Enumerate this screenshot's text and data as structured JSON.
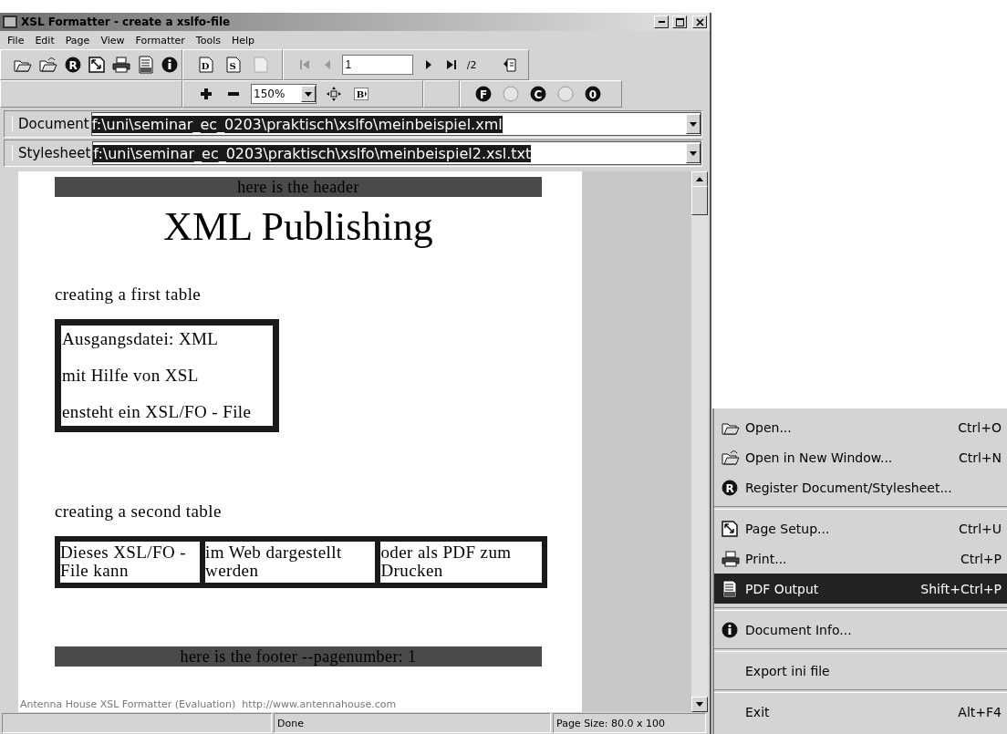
{
  "window": {
    "title": "XSL Formatter - create a xslfo-file"
  },
  "menu_bar": [
    "File",
    "Edit",
    "Page",
    "View",
    "Formatter",
    "Tools",
    "Help"
  ],
  "toolbar": {
    "file_buttons": [
      {
        "kind": "open"
      },
      {
        "kind": "open-new"
      },
      {
        "kind": "letter",
        "letter": "R"
      },
      {
        "kind": "page-setup"
      },
      {
        "kind": "print"
      },
      {
        "kind": "pdf"
      },
      {
        "kind": "info"
      }
    ],
    "view_buttons": [
      {
        "kind": "doc",
        "letter": "D",
        "disabled": false
      },
      {
        "kind": "doc",
        "letter": "S",
        "disabled": false
      },
      {
        "kind": "doc",
        "disabled": true
      }
    ],
    "nav": {
      "first_disabled": true,
      "prev_disabled": true,
      "page": "1",
      "next_disabled": false,
      "last_disabled": false,
      "total": "/2"
    },
    "zoom": {
      "value": "150%",
      "fit_width_letter": "B"
    },
    "mode_buttons": [
      {
        "letter": "F",
        "disabled": false
      },
      {
        "disabled": true
      },
      {
        "letter": "C",
        "disabled": false
      },
      {
        "disabled": true
      },
      {
        "letter": "0",
        "disabled": false
      }
    ]
  },
  "sources": [
    {
      "label": "Document",
      "value": "f:\\uni\\seminar_ec_0203\\praktisch\\xslfo\\meinbeispiel.xml",
      "selected": true
    },
    {
      "label": "Stylesheet",
      "value": "f:\\uni\\seminar_ec_0203\\praktisch\\xslfo\\meinbeispiel2.xsl.txt",
      "selected": true
    }
  ],
  "page": {
    "header": "here is the header",
    "title": "XML Publishing",
    "intro_1": "creating a first table",
    "table_1": [
      "Ausgangsdatei: XML",
      "mit Hilfe von XSL",
      "ensteht ein XSL/FO - File"
    ],
    "intro_2": "creating a second table",
    "table_2": [
      "Dieses XSL/FO - File kann",
      "im Web dargestellt werden",
      "oder als PDF zum Drucken"
    ],
    "footer": "here is the footer --pagenumber: 1"
  },
  "evaluation_note": "Antenna House XSL Formatter (Evaluation)  http://www.antennahouse.com",
  "status_bar": [
    "Done",
    "Page Size: 80.0 x 100"
  ],
  "context_menu": [
    [
      {
        "kind": "open",
        "label": "Open...",
        "shortcut": "Ctrl+O",
        "selected": false
      },
      {
        "kind": "open-new",
        "label": "Open in New Window...",
        "shortcut": "Ctrl+N",
        "selected": false
      },
      {
        "kind": "letter",
        "letter": "R",
        "label": "Register Document/Stylesheet...",
        "selected": false
      }
    ],
    [
      {
        "kind": "page-setup",
        "label": "Page Setup...",
        "shortcut": "Ctrl+U",
        "selected": false
      },
      {
        "kind": "print",
        "label": "Print...",
        "shortcut": "Ctrl+P",
        "selected": false
      },
      {
        "kind": "pdf",
        "label": "PDF Output",
        "shortcut": "Shift+Ctrl+P",
        "selected": true
      }
    ],
    [
      {
        "kind": "info",
        "label": "Document Info...",
        "selected": false
      }
    ],
    [
      {
        "kind": "none",
        "label": "Export ini file",
        "selected": false
      }
    ],
    [
      {
        "kind": "none",
        "label": "Exit",
        "shortcut": "Alt+F4",
        "selected": false
      }
    ]
  ]
}
